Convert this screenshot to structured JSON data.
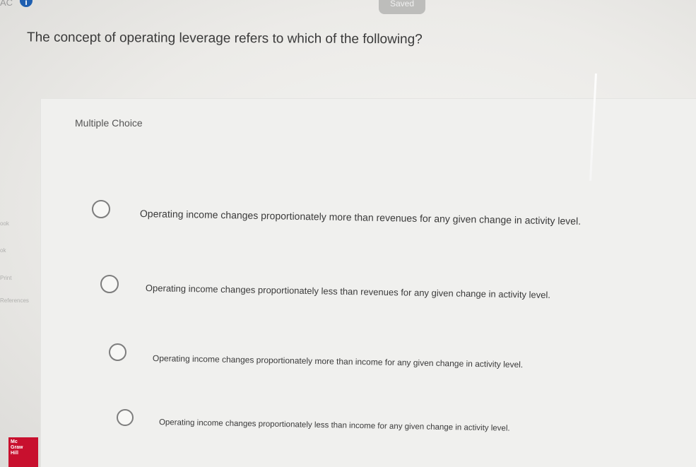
{
  "header": {
    "corner_text": "AC",
    "info_badge": "i",
    "saved_label": "Saved"
  },
  "question": {
    "text": "The concept of operating leverage refers to which of the following?"
  },
  "answer_panel": {
    "type_label": "Multiple Choice",
    "options": [
      {
        "text": "Operating income changes proportionately more than revenues for any given change in activity level."
      },
      {
        "text": "Operating income changes proportionately less than revenues for any given change in activity level."
      },
      {
        "text": "Operating income changes proportionately more than income for any given change in activity level."
      },
      {
        "text": "Operating income changes proportionately less than income for any given change in activity level."
      }
    ]
  },
  "side_nav": {
    "items": [
      {
        "label": "ook"
      },
      {
        "label": "ok"
      },
      {
        "label": "Print"
      },
      {
        "label": "References"
      }
    ]
  },
  "logo": {
    "lines": [
      "Mc",
      "Graw",
      "Hill"
    ]
  },
  "colors": {
    "accent": "#1f5fb0",
    "brand": "#c8102e"
  }
}
